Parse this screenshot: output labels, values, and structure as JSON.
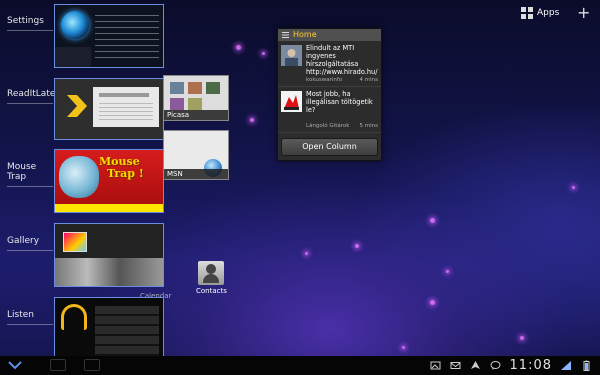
{
  "recent_apps": [
    {
      "label": "Settings"
    },
    {
      "label": "ReadItLater"
    },
    {
      "label": "Mouse Trap"
    },
    {
      "label": "Gallery"
    },
    {
      "label": "Listen"
    }
  ],
  "thumb_text": {
    "mousetrap_line1": "Mouse",
    "mousetrap_line2": "Trap !"
  },
  "side_thumbs": {
    "picasa": "Picasa",
    "msn": "MSN",
    "calendar": "Calendar"
  },
  "shortcut": {
    "contacts": "Contacts"
  },
  "widget": {
    "title": "Home",
    "tweets": [
      {
        "text": "Elindult az MTI ingyenes hírszolgáltatása http://www.hirado.hu/",
        "author": "kokuswarinfo",
        "time": "4 mins",
        "avatar": "photo"
      },
      {
        "text": "Most jobb, ha illegálisan töltögetik le?",
        "author": "Lángoló Gitárok",
        "time": "5 mins",
        "avatar": "cartoon"
      }
    ],
    "open_button": "Open Column"
  },
  "topbar": {
    "apps_label": "Apps",
    "add_label": "+"
  },
  "statusbar": {
    "clock": "11:08"
  },
  "colors": {
    "accent_border": "#6a8de0",
    "widget_title": "#ffcc33"
  },
  "icons": [
    "chevron-down-icon",
    "apps-grid-icon",
    "plus-icon",
    "gallery-icon",
    "email-icon",
    "nav-arrow-icon",
    "chat-icon",
    "wifi-icon",
    "battery-icon"
  ]
}
